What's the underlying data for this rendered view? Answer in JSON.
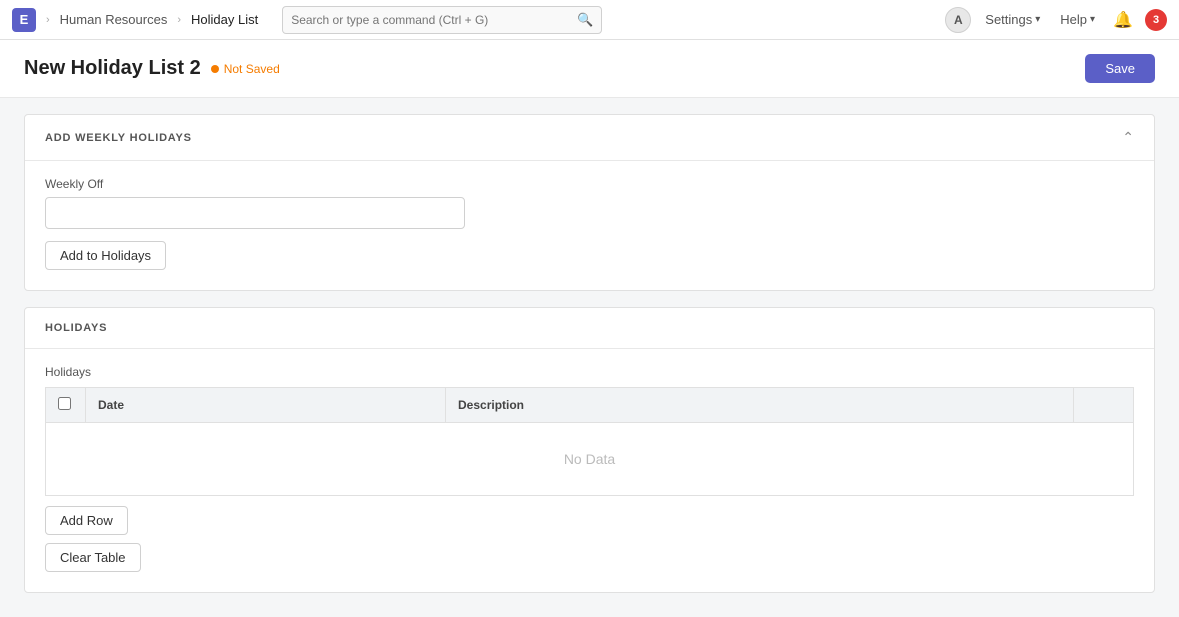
{
  "navbar": {
    "logo_letter": "E",
    "breadcrumbs": [
      "Human Resources",
      "Holiday List"
    ],
    "search_placeholder": "Search or type a command (Ctrl + G)",
    "avatar_letter": "A",
    "settings_label": "Settings",
    "help_label": "Help",
    "notification_count": "3"
  },
  "page": {
    "title": "New Holiday List 2",
    "not_saved_label": "Not Saved",
    "save_button_label": "Save"
  },
  "weekly_holidays_section": {
    "title": "ADD WEEKLY HOLIDAYS",
    "weekly_off_label": "Weekly Off",
    "add_button_label": "Add to Holidays"
  },
  "holidays_section": {
    "title": "HOLIDAYS",
    "holidays_label": "Holidays",
    "table": {
      "columns": [
        "Date",
        "Description"
      ],
      "no_data_text": "No Data"
    },
    "add_row_label": "Add Row",
    "clear_table_label": "Clear Table"
  }
}
